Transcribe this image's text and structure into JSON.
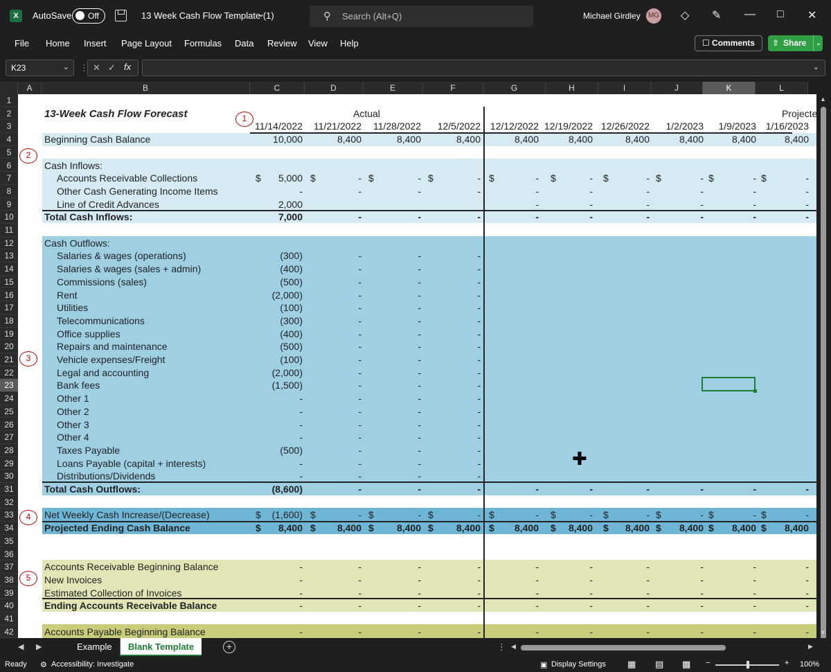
{
  "titlebar": {
    "app_logo": "X",
    "autosave_label": "AutoSave",
    "autosave_state": "Off",
    "document_title": "13 Week Cash Flow Template (1)",
    "search_placeholder": "Search (Alt+Q)",
    "user_name": "Michael Girdley",
    "user_initials": "MG"
  },
  "menu": {
    "items": [
      "File",
      "Home",
      "Insert",
      "Page Layout",
      "Formulas",
      "Data",
      "Review",
      "View",
      "Help"
    ],
    "comments": "Comments",
    "share": "Share"
  },
  "formula_bar": {
    "name_box": "K23",
    "formula": ""
  },
  "columns": [
    "A",
    "B",
    "C",
    "D",
    "E",
    "F",
    "G",
    "H",
    "I",
    "J",
    "K",
    "L"
  ],
  "selected_column": "K",
  "rows": [
    "1",
    "2",
    "3",
    "4",
    "5",
    "6",
    "7",
    "8",
    "9",
    "10",
    "11",
    "12",
    "13",
    "14",
    "15",
    "16",
    "17",
    "18",
    "19",
    "20",
    "21",
    "22",
    "23",
    "24",
    "25",
    "26",
    "27",
    "28",
    "29",
    "30",
    "31",
    "32",
    "33",
    "34",
    "35",
    "36",
    "37",
    "38",
    "39",
    "40",
    "41",
    "42"
  ],
  "selected_row": "23",
  "sheet": {
    "title": "13-Week  Cash Flow Forecast",
    "actual_label": "Actual",
    "projected_label": "Projecte",
    "dates": [
      "11/14/2022",
      "11/21/2022",
      "11/28/2022",
      "12/5/2022",
      "12/12/2022",
      "12/19/2022",
      "12/26/2022",
      "1/2/2023",
      "1/9/2023",
      "1/16/2023"
    ],
    "beginning_cash": {
      "label": "Beginning Cash Balance",
      "values": [
        "10,000",
        "8,400",
        "8,400",
        "8,400",
        "8,400",
        "8,400",
        "8,400",
        "8,400",
        "8,400",
        "8,400"
      ]
    },
    "cash_inflows_label": "Cash Inflows:",
    "inflows": [
      {
        "label": "Accounts Receivable Collections",
        "values": [
          "5,000",
          "-",
          "-",
          "-",
          "-",
          "-",
          "-",
          "-",
          "-",
          "-"
        ]
      },
      {
        "label": "Other Cash Generating Income Items",
        "values": [
          "-",
          "-",
          "-",
          "-",
          "-",
          "-",
          "-",
          "-",
          "-",
          "-"
        ]
      },
      {
        "label": "Line of Credit Advances",
        "values": [
          "2,000",
          "",
          "",
          "",
          "-",
          "-",
          "-",
          "-",
          "-",
          "-"
        ]
      }
    ],
    "total_inflows": {
      "label": "Total Cash Inflows:",
      "values": [
        "7,000",
        "-",
        "-",
        "-",
        "-",
        "-",
        "-",
        "-",
        "-",
        "-"
      ]
    },
    "cash_outflows_label": "Cash Outflows:",
    "outflows": [
      {
        "label": "Salaries & wages (operations)",
        "value": "(300)"
      },
      {
        "label": "Salaries & wages (sales + admin)",
        "value": "(400)"
      },
      {
        "label": "Commissions (sales)",
        "value": "(500)"
      },
      {
        "label": "Rent",
        "value": "(2,000)"
      },
      {
        "label": "Utilities",
        "value": "(100)"
      },
      {
        "label": "Telecommunications",
        "value": "(300)"
      },
      {
        "label": "Office supplies",
        "value": "(400)"
      },
      {
        "label": "Repairs and maintenance",
        "value": "(500)"
      },
      {
        "label": "Vehicle expenses/Freight",
        "value": "(100)"
      },
      {
        "label": "Legal and accounting",
        "value": "(2,000)"
      },
      {
        "label": "Bank fees",
        "value": "(1,500)"
      },
      {
        "label": "Other 1",
        "value": "-"
      },
      {
        "label": "Other 2",
        "value": "-"
      },
      {
        "label": "Other 3",
        "value": "-"
      },
      {
        "label": "Other 4",
        "value": "-"
      },
      {
        "label": "Taxes Payable",
        "value": "(500)"
      },
      {
        "label": "Loans Payable (capital + interests)",
        "value": "-"
      },
      {
        "label": "Distributions/Dividends",
        "value": "-"
      }
    ],
    "outflow_blank": "-",
    "total_outflows": {
      "label": "Total Cash Outflows:",
      "values": [
        "(8,600)",
        "-",
        "-",
        "-",
        "-",
        "-",
        "-",
        "-",
        "-",
        "-"
      ]
    },
    "net_change": {
      "label": "Net Weekly Cash Increase/(Decrease)",
      "values": [
        "(1,600)",
        "-",
        "-",
        "-",
        "-",
        "-",
        "-",
        "-",
        "-",
        "-"
      ]
    },
    "ending_cash": {
      "label": "Projected Ending Cash Balance",
      "values": [
        "8,400",
        "8,400",
        "8,400",
        "8,400",
        "8,400",
        "8,400",
        "8,400",
        "8,400",
        "8,400",
        "8,400"
      ]
    },
    "currency": "$",
    "ar_rows": [
      {
        "label": "Accounts Receivable Beginning Balance"
      },
      {
        "label": "New Invoices"
      },
      {
        "label": "Estimated Collection of Invoices"
      }
    ],
    "ar_total": {
      "label": "Ending Accounts Receivable Balance"
    },
    "ap_begin": {
      "label": "Accounts Payable Beginning Balance"
    },
    "markers": [
      "1",
      "2",
      "3",
      "4",
      "5"
    ]
  },
  "sheet_tabs": {
    "example": "Example",
    "blank": "Blank Template"
  },
  "status": {
    "ready": "Ready",
    "accessibility": "Accessibility: Investigate",
    "display_settings": "Display Settings",
    "zoom": "100%"
  },
  "colors": {
    "band_light": "#d6eaf4",
    "band_outflows": "#9fcfe3",
    "band_net": "#6fb6d6",
    "band_ar": "#e2e6b7",
    "band_ap": "#c7cd79",
    "accent": "#1e7e34"
  },
  "icons": [
    "excel-logo-icon",
    "save-icon",
    "chevron-down-icon",
    "search-icon",
    "diamond-icon",
    "pen-icon",
    "minimize-icon",
    "maximize-icon",
    "close-icon",
    "comment-icon",
    "share-icon",
    "fx-icon",
    "plus-cursor-icon"
  ]
}
